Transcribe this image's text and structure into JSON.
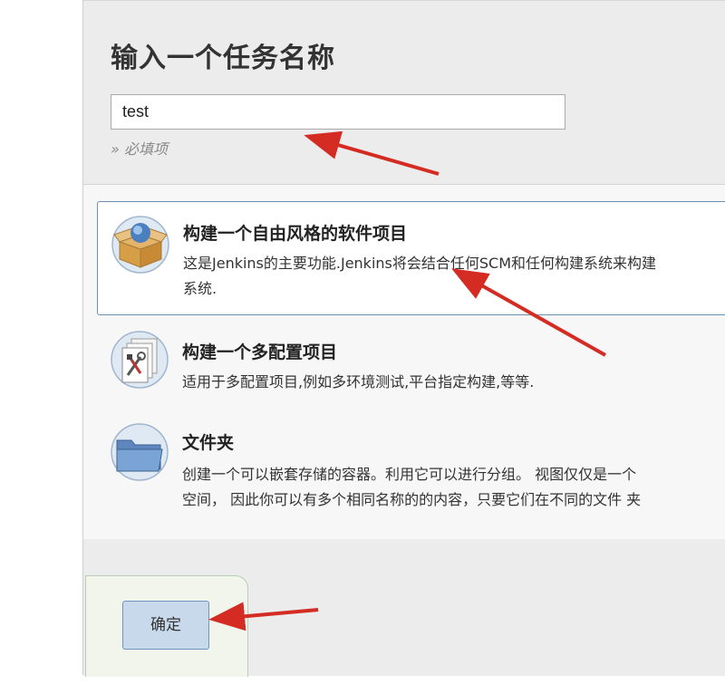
{
  "header": {
    "title": "输入一个任务名称",
    "name_value": "test",
    "required_hint": "» 必填项"
  },
  "item_types": [
    {
      "name": "构建一个自由风格的软件项目",
      "desc_line1": "这是Jenkins的主要功能.Jenkins将会结合任何SCM和任何构建系统来构建",
      "desc_line2": "系统.",
      "icon": "freestyle-box-globe-icon",
      "selected": true
    },
    {
      "name": "构建一个多配置项目",
      "desc_line1": "适用于多配置项目,例如多环境测试,平台指定构建,等等.",
      "desc_line2": "",
      "icon": "multi-config-tools-icon",
      "selected": false
    },
    {
      "name": "文件夹",
      "desc_line1": "创建一个可以嵌套存储的容器。利用它可以进行分组。 视图仅仅是一个",
      "desc_line2": "空间， 因此你可以有多个相同名称的的内容，只要它们在不同的文件 夹",
      "icon": "folder-icon",
      "selected": false
    }
  ],
  "footer": {
    "ok_label": "确定"
  },
  "colors": {
    "arrow": "#d42b22",
    "selected_border": "#6f8fb0",
    "ok_button_bg": "#c8d9ec"
  }
}
